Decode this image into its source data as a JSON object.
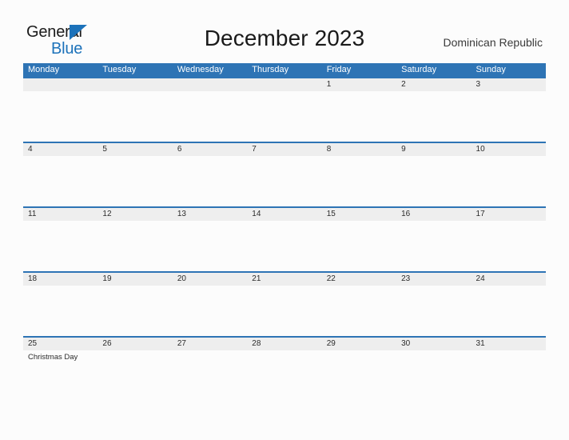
{
  "brand": {
    "name_part1": "General",
    "name_part2": "Blue",
    "triangle_color": "#1c72ba",
    "text_color": "#1b1b1b"
  },
  "header": {
    "title": "December 2023",
    "region": "Dominican Republic"
  },
  "theme": {
    "header_blue": "#2e74b5",
    "band_gray": "#eeeeee",
    "page_background": "#fcfcfc",
    "text_color": "#2b2b2b"
  },
  "calendar": {
    "month": "December",
    "year": "2023",
    "weekday_headers": [
      "Monday",
      "Tuesday",
      "Wednesday",
      "Thursday",
      "Friday",
      "Saturday",
      "Sunday"
    ],
    "weeks": [
      {
        "days": [
          {
            "number": "",
            "event": ""
          },
          {
            "number": "",
            "event": ""
          },
          {
            "number": "",
            "event": ""
          },
          {
            "number": "",
            "event": ""
          },
          {
            "number": "1",
            "event": ""
          },
          {
            "number": "2",
            "event": ""
          },
          {
            "number": "3",
            "event": ""
          }
        ]
      },
      {
        "days": [
          {
            "number": "4",
            "event": ""
          },
          {
            "number": "5",
            "event": ""
          },
          {
            "number": "6",
            "event": ""
          },
          {
            "number": "7",
            "event": ""
          },
          {
            "number": "8",
            "event": ""
          },
          {
            "number": "9",
            "event": ""
          },
          {
            "number": "10",
            "event": ""
          }
        ]
      },
      {
        "days": [
          {
            "number": "11",
            "event": ""
          },
          {
            "number": "12",
            "event": ""
          },
          {
            "number": "13",
            "event": ""
          },
          {
            "number": "14",
            "event": ""
          },
          {
            "number": "15",
            "event": ""
          },
          {
            "number": "16",
            "event": ""
          },
          {
            "number": "17",
            "event": ""
          }
        ]
      },
      {
        "days": [
          {
            "number": "18",
            "event": ""
          },
          {
            "number": "19",
            "event": ""
          },
          {
            "number": "20",
            "event": ""
          },
          {
            "number": "21",
            "event": ""
          },
          {
            "number": "22",
            "event": ""
          },
          {
            "number": "23",
            "event": ""
          },
          {
            "number": "24",
            "event": ""
          }
        ]
      },
      {
        "days": [
          {
            "number": "25",
            "event": "Christmas Day"
          },
          {
            "number": "26",
            "event": ""
          },
          {
            "number": "27",
            "event": ""
          },
          {
            "number": "28",
            "event": ""
          },
          {
            "number": "29",
            "event": ""
          },
          {
            "number": "30",
            "event": ""
          },
          {
            "number": "31",
            "event": ""
          }
        ]
      }
    ]
  }
}
